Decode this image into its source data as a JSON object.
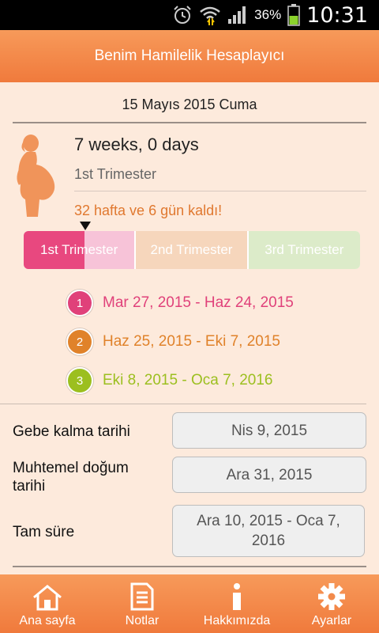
{
  "status_bar": {
    "battery_percent": "36%",
    "time": "10:31"
  },
  "app": {
    "title": "Benim Hamilelik Hesaplayıcı"
  },
  "current_date": "15 Mayıs 2015 Cuma",
  "pregnancy": {
    "weeks_days": "7 weeks, 0 days",
    "trimester": "1st Trimester",
    "remaining": "32 hafta ve 6 gün kaldı!",
    "progress_in_first_trimester": 0.55
  },
  "trimester_bar": {
    "labels": [
      "1st Trimester",
      "2nd Trimester",
      "3rd Trimester"
    ]
  },
  "trimester_ranges": [
    {
      "number": "1",
      "dates": "Mar 27, 2015 - Haz 24, 2015",
      "color": "#e0417a"
    },
    {
      "number": "2",
      "dates": "Haz 25, 2015 - Eki 7, 2015",
      "color": "#e0822a"
    },
    {
      "number": "3",
      "dates": "Eki 8, 2015 - Oca 7, 2016",
      "color": "#9cbf1f"
    }
  ],
  "details": {
    "conception_label": "Gebe kalma tarihi",
    "conception_value": "Nis 9, 2015",
    "due_label": "Muhtemel doğum tarihi",
    "due_value": "Ara 31, 2015",
    "fullterm_label": "Tam süre",
    "fullterm_value": "Ara 10, 2015 - Oca 7, 2016"
  },
  "tabs": [
    {
      "label": "Ana sayfa",
      "icon": "home-icon"
    },
    {
      "label": "Notlar",
      "icon": "notes-icon"
    },
    {
      "label": "Hakkımızda",
      "icon": "info-icon"
    },
    {
      "label": "Ayarlar",
      "icon": "gear-icon"
    }
  ],
  "colors": {
    "accent": "#f07a3c",
    "pink": "#e8487f"
  }
}
